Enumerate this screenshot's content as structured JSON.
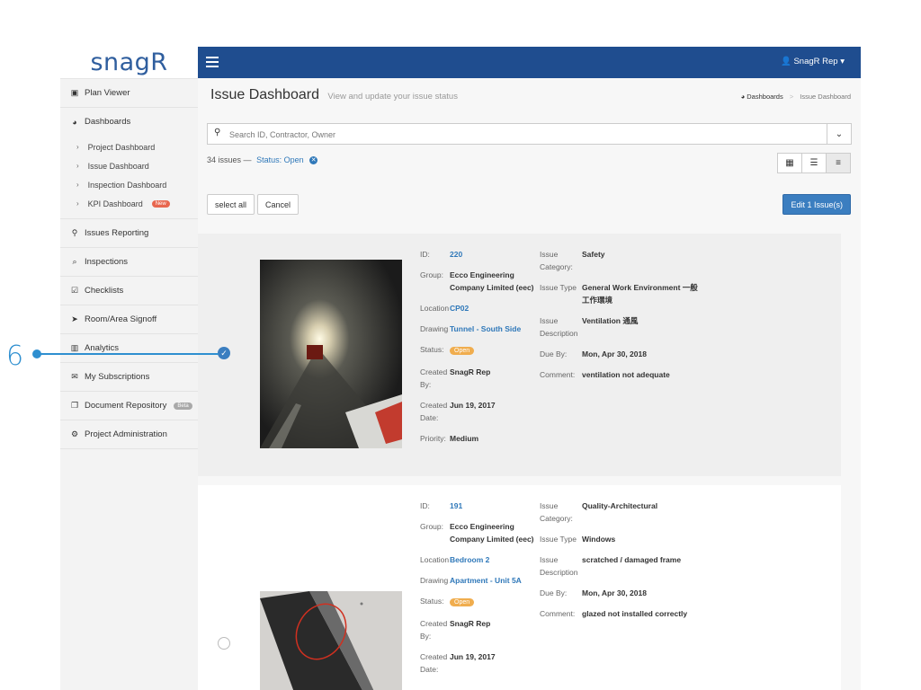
{
  "logo": "snagR",
  "topbar": {
    "user": "SnagR Rep"
  },
  "sidebar": {
    "items": [
      {
        "label": "Plan Viewer",
        "icon": "image-icon"
      },
      {
        "label": "Dashboards",
        "icon": "dashboard-icon"
      },
      {
        "label": "Issues Reporting",
        "icon": "map-marker-icon"
      },
      {
        "label": "Inspections",
        "icon": "search-icon"
      },
      {
        "label": "Checklists",
        "icon": "checkbox-icon"
      },
      {
        "label": "Room/Area Signoff",
        "icon": "location-arrow-icon"
      },
      {
        "label": "Analytics",
        "icon": "bar-chart-icon"
      },
      {
        "label": "My Subscriptions",
        "icon": "envelope-icon"
      },
      {
        "label": "Document Repository",
        "icon": "documents-icon"
      },
      {
        "label": "Project Administration",
        "icon": "gears-icon"
      }
    ],
    "dashboard_sub": [
      "Project Dashboard",
      "Issue Dashboard",
      "Inspection Dashboard",
      "KPI Dashboard"
    ],
    "new_badge": "New",
    "beta_badge": "Beta"
  },
  "header": {
    "title": "Issue Dashboard",
    "subtitle": "View and update your issue status",
    "crumb_root": "Dashboards",
    "crumb_current": "Issue Dashboard"
  },
  "search": {
    "placeholder": "Search ID, Contractor, Owner"
  },
  "filters": {
    "count": "34 issues",
    "dash": "—",
    "status": "Status: Open"
  },
  "buttons": {
    "select_all": "select all",
    "cancel": "Cancel",
    "edit": "Edit  1 Issue(s)"
  },
  "annotation": {
    "number": "6"
  },
  "labels": {
    "id": "ID:",
    "group": "Group:",
    "location": "Location",
    "drawing": "Drawing",
    "status": "Status:",
    "created_by": "Created By:",
    "created_date": "Created Date:",
    "priority": "Priority:",
    "issue_category": "Issue Category:",
    "issue_type": "Issue Type",
    "issue_description": "Issue Description",
    "due_by": "Due By:",
    "comment": "Comment:"
  },
  "issues": [
    {
      "id": "220",
      "group": "Ecco Engineering Company Limited (eec)",
      "location": "CP02",
      "drawing": "Tunnel - South Side",
      "status": "Open",
      "created_by": "SnagR Rep",
      "created_date": "Jun 19, 2017",
      "priority": "Medium",
      "category": "Safety",
      "type": "General Work Environment 一般工作環境",
      "description": "Ventilation 通風",
      "due": "Mon, Apr 30, 2018",
      "comment": "ventilation not adequate",
      "selected": true
    },
    {
      "id": "191",
      "group": "Ecco Engineering Company Limited (eec)",
      "location": "Bedroom 2",
      "drawing": "Apartment - Unit 5A",
      "status": "Open",
      "created_by": "SnagR Rep",
      "created_date": "Jun 19, 2017",
      "category": "Quality-Architectural",
      "type": "Windows",
      "description": "scratched / damaged frame",
      "due": "Mon, Apr 30, 2018",
      "comment": "glazed not installed correctly",
      "selected": false
    }
  ]
}
